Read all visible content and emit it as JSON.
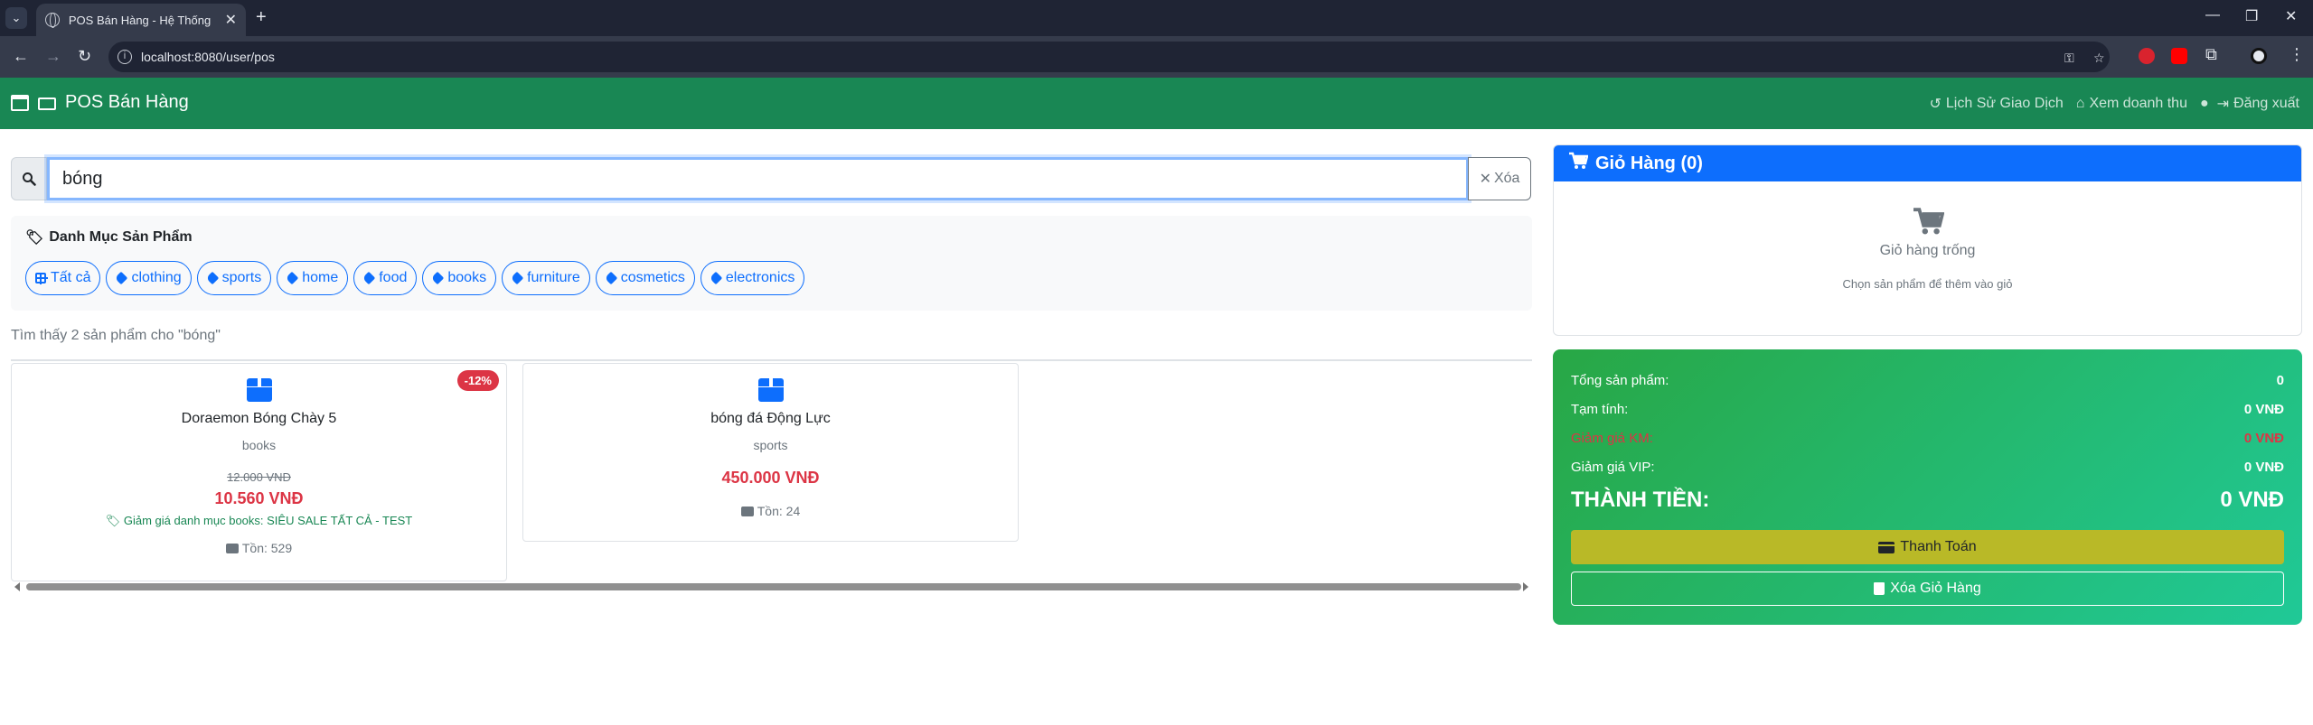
{
  "browser": {
    "tab_title": "POS Bán Hàng - Hệ Thống Quản Lý",
    "url": "localhost:8080/user/pos"
  },
  "navbar": {
    "brand": "POS Bán Hàng",
    "links": [
      {
        "label": "Lịch Sử Giao Dịch",
        "icon": "history-icon"
      },
      {
        "label": "Xem doanh thu",
        "icon": "home-icon"
      },
      {
        "label": "",
        "icon": "user-icon"
      },
      {
        "label": "Đăng xuất",
        "icon": "logout-icon"
      }
    ]
  },
  "search": {
    "value": "bóng",
    "clear_label": "Xóa"
  },
  "categories": {
    "title": "Danh Mục Sản Phẩm",
    "items": [
      "Tất cả",
      "clothing",
      "sports",
      "home",
      "food",
      "books",
      "furniture",
      "cosmetics",
      "electronics"
    ]
  },
  "results": {
    "text": "Tìm thấy 2 sản phẩm cho \"bóng\""
  },
  "products": [
    {
      "name": "Doraemon Bóng Chày 5",
      "category": "books",
      "old_price": "12.000 VNĐ",
      "price": "10.560 VNĐ",
      "discount": "Giảm giá danh mục books: SIÊU SALE TẤT CẢ - TEST",
      "stock": "Tồn: 529",
      "badge": "-12%"
    },
    {
      "name": "bóng đá Động Lực",
      "category": "sports",
      "price": "450.000 VNĐ",
      "stock": "Tồn: 24"
    }
  ],
  "cart": {
    "title": "Giỏ Hàng (0)",
    "empty_text": "Giỏ hàng trống",
    "hint": "Chọn sản phẩm để thêm vào giỏ"
  },
  "summary": {
    "total_items_label": "Tổng sản phẩm:",
    "total_items_value": "0",
    "subtotal_label": "Tạm tính:",
    "subtotal_value": "0 VNĐ",
    "promo_label": "Giảm giá KM:",
    "promo_value": "0 VNĐ",
    "vip_label": "Giảm giá VIP:",
    "vip_value": "0 VNĐ",
    "grand_label": "THÀNH TIỀN:",
    "grand_value": "0 VNĐ",
    "pay_label": "Thanh Toán",
    "clear_label": "Xóa Giỏ Hàng"
  },
  "colors": {
    "navbar": "#198754",
    "primary": "#0d6efd",
    "danger": "#dc3545",
    "summary_gradient_start": "#28a745",
    "summary_gradient_end": "#20c997",
    "pay_button": "#b9b927"
  }
}
